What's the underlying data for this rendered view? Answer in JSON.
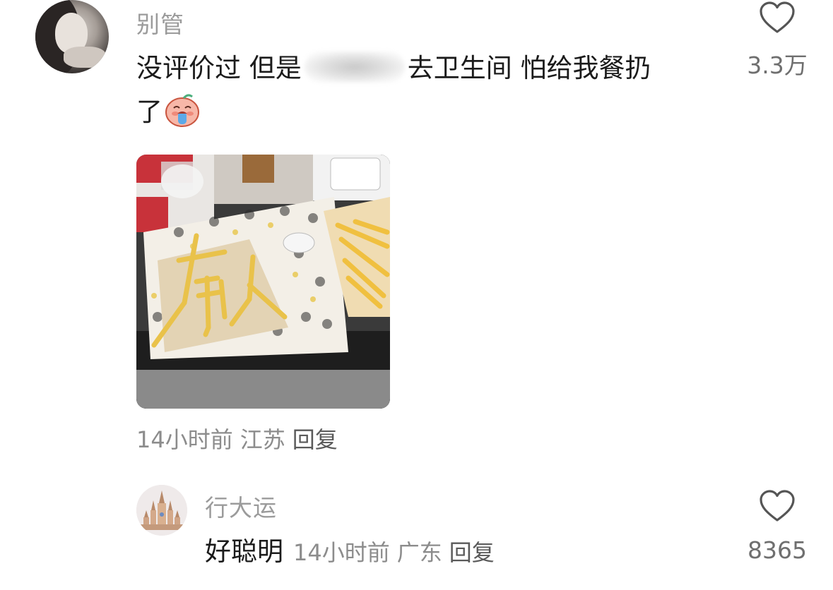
{
  "comments": [
    {
      "username": "别管",
      "text_part1": "没评价过  但是",
      "text_part2": "去卫生间 怕给我餐扔",
      "text_part3": "了",
      "likes": "3.3万",
      "time": "14小时前",
      "location": "江苏",
      "reply_label": "回复",
      "image_text": "有人"
    },
    {
      "username": "行大运",
      "text": "好聪明",
      "time": "14小时前",
      "location": "广东",
      "reply_label": "回复",
      "likes": "8365"
    }
  ],
  "icons": {
    "like": "heart-outline-icon",
    "emoji": "crying-emoji-icon"
  },
  "colors": {
    "username": "#9b9b9b",
    "text": "#1b1b1b",
    "meta": "#8c8c8c",
    "like": "#6f6f6f"
  }
}
